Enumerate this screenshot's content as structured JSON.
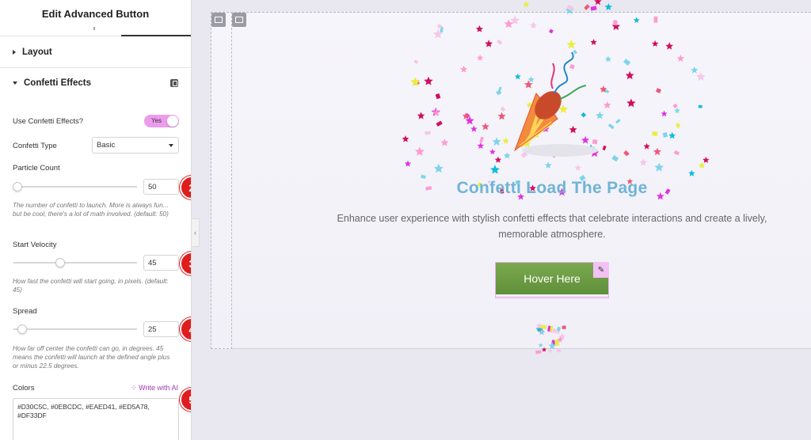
{
  "panel": {
    "title": "Edit Advanced Button",
    "sections": {
      "layout": "Layout",
      "confetti": "Confetti Effects"
    },
    "use_confetti": {
      "label": "Use Confetti Effects?",
      "value": "Yes"
    },
    "confetti_type": {
      "label": "Confetti Type",
      "value": "Basic"
    },
    "particle_count": {
      "label": "Particle Count",
      "value": "50",
      "fraction": 0.03,
      "help": "The number of confetti to launch. More is always fun... but be cool, there's a lot of math involved. (default: 50)"
    },
    "start_velocity": {
      "label": "Start Velocity",
      "value": "45",
      "fraction": 0.38,
      "help": "How fast the confetti will start going, in pixels. (default: 45)"
    },
    "spread": {
      "label": "Spread",
      "value": "25",
      "fraction": 0.07,
      "help": "How far off center the confetti can go, in degrees. 45 means the confetti will launch at the defined angle plus or minus 22.5 degrees."
    },
    "colors": {
      "label": "Colors",
      "ai_link": "Write with AI",
      "value": "#D30C5C, #0EBCDC, #EAED41, #ED5A78, #DF33DF"
    },
    "badges": [
      "2",
      "3",
      "4",
      "5"
    ],
    "collapse_glyph": "‹"
  },
  "canvas": {
    "heading": "Confetti Load The Page",
    "description": "Enhance user experience with stylish confetti effects that celebrate interactions and create a lively, memorable atmosphere.",
    "button_label": "Hover Here",
    "edit_glyph": "✎"
  },
  "colors": {
    "confetti": [
      "#D30C5C",
      "#0EBCDC",
      "#EAED41",
      "#ED5A78",
      "#DF33DF"
    ],
    "toggle": "#ec9ceb",
    "button": "#6a9a42",
    "badge": "#e11c1c",
    "heading": "#6fb4d6"
  }
}
